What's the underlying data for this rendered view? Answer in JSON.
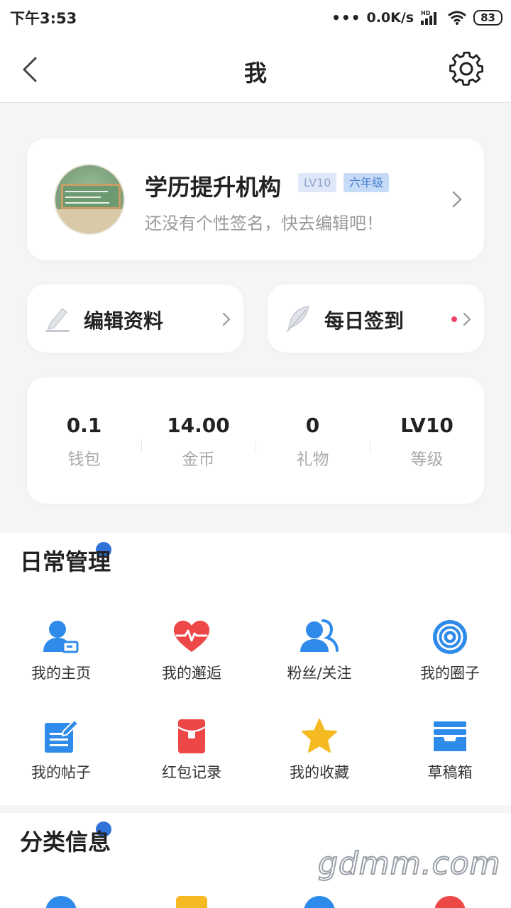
{
  "status_bar": {
    "time": "下午3:53",
    "network_speed": "0.0K/s",
    "hd": "HD",
    "battery": "83"
  },
  "header": {
    "title": "我"
  },
  "profile": {
    "name": "学历提升机构",
    "level_badge": "LV10",
    "grade_badge": "六年级",
    "signature": "还没有个性签名，快去编辑吧！"
  },
  "actions": {
    "edit_label": "编辑资料",
    "checkin_label": "每日签到"
  },
  "stats": [
    {
      "value": "0.1",
      "label": "钱包"
    },
    {
      "value": "14.00",
      "label": "金币"
    },
    {
      "value": "0",
      "label": "礼物"
    },
    {
      "value": "LV10",
      "label": "等级"
    }
  ],
  "daily": {
    "title": "日常管理",
    "items": [
      {
        "label": "我的主页",
        "icon": "user-card-icon"
      },
      {
        "label": "我的邂逅",
        "icon": "heartbeat-icon"
      },
      {
        "label": "粉丝/关注",
        "icon": "followers-icon"
      },
      {
        "label": "我的圈子",
        "icon": "circle-target-icon"
      },
      {
        "label": "我的帖子",
        "icon": "post-edit-icon"
      },
      {
        "label": "红包记录",
        "icon": "red-envelope-icon"
      },
      {
        "label": "我的收藏",
        "icon": "star-icon"
      },
      {
        "label": "草稿箱",
        "icon": "inbox-tray-icon"
      }
    ]
  },
  "categories": {
    "title": "分类信息"
  },
  "watermark": "gdmm.com",
  "colors": {
    "accent_blue": "#2f8bea",
    "heart_red": "#ee4747",
    "star_yellow": "#f5b921",
    "badge_dot": "#2f72d8",
    "checkin_dot": "#f04269"
  }
}
